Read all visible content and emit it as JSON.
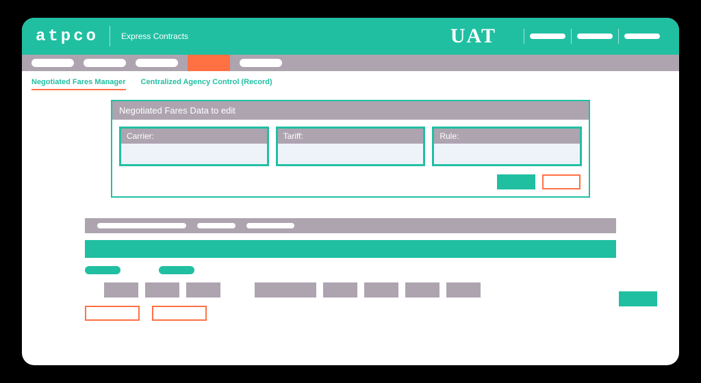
{
  "header": {
    "logo": "atpco",
    "appTitle": "Express Contracts",
    "env": "UAT"
  },
  "subnav": {
    "tab1": "Negotiated Fares Manager",
    "tab2": "Centralized Agency Control (Record)"
  },
  "panel": {
    "title": "Negotiated Fares Data to edit",
    "fields": {
      "carrier": {
        "label": "Carrier:",
        "value": ""
      },
      "tariff": {
        "label": "Tariff:",
        "value": ""
      },
      "rule": {
        "label": "Rule:",
        "value": ""
      }
    }
  }
}
